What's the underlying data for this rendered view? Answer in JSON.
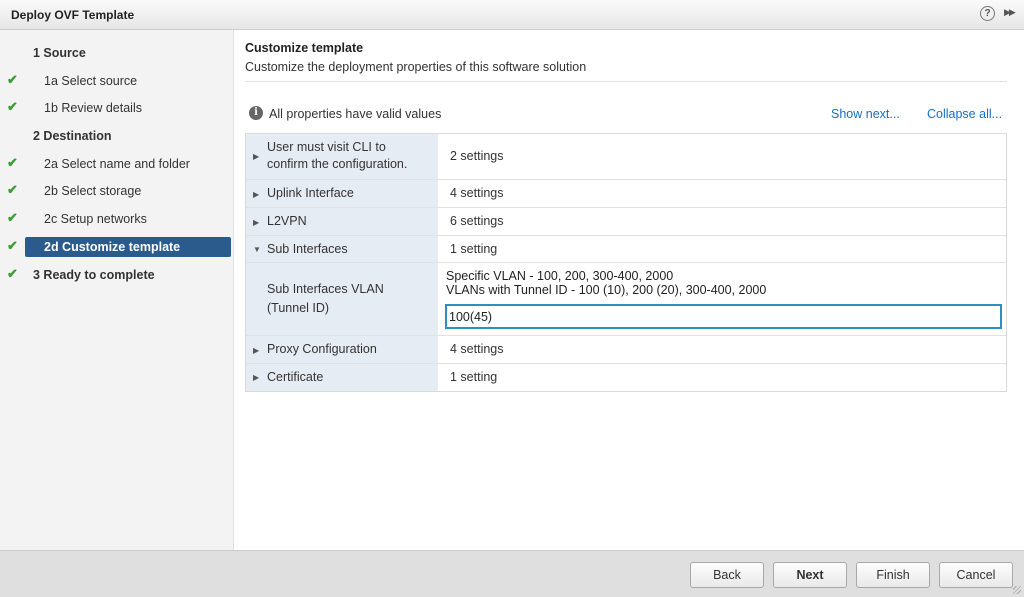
{
  "window": {
    "title": "Deploy OVF Template",
    "help_icon": "?",
    "expand_icon": "▶▶"
  },
  "steps": [
    {
      "label": "1  Source",
      "checked": false,
      "major": true
    },
    {
      "label": "1a  Select source",
      "checked": true
    },
    {
      "label": "1b  Review details",
      "checked": true
    },
    {
      "label": "2  Destination",
      "checked": false,
      "major": true
    },
    {
      "label": "2a  Select name and folder",
      "checked": true
    },
    {
      "label": "2b  Select storage",
      "checked": true
    },
    {
      "label": "2c  Setup networks",
      "checked": true
    },
    {
      "label": "2d  Customize template",
      "checked": true,
      "active": true
    },
    {
      "label": "3  Ready to complete",
      "checked": true,
      "major": true
    }
  ],
  "main": {
    "title": "Customize template",
    "subtitle": "Customize the deployment properties of this software solution",
    "valid_text": "All properties have valid values",
    "show_next": "Show next...",
    "collapse_all": "Collapse all..."
  },
  "properties": [
    {
      "name": "User must visit CLI to\nconfirm the configuration.",
      "value": "2 settings",
      "expanded": false
    },
    {
      "name": "Uplink Interface",
      "value": "4 settings",
      "expanded": false
    },
    {
      "name": "L2VPN",
      "value": "6 settings",
      "expanded": false
    },
    {
      "name": "Sub Interfaces",
      "value": "1 setting",
      "expanded": true
    },
    {
      "name": "Proxy Configuration",
      "value": "4 settings",
      "expanded": false
    },
    {
      "name": "Certificate",
      "value": "1 setting",
      "expanded": false
    }
  ],
  "sub_interfaces_vlan": {
    "label": "Sub Interfaces VLAN\n(Tunnel ID)",
    "hint_line1": "Specific VLAN - 100, 200, 300-400, 2000",
    "hint_line2": "VLANs with Tunnel ID - 100 (10), 200 (20), 300-400, 2000",
    "value": "100(45)"
  },
  "buttons": {
    "back": "Back",
    "next": "Next",
    "finish": "Finish",
    "cancel": "Cancel"
  },
  "colors": {
    "accent": "#2b5a8c",
    "check": "#3c9c36",
    "link": "#1a6ec2",
    "input_focus": "#2f8fc4"
  }
}
